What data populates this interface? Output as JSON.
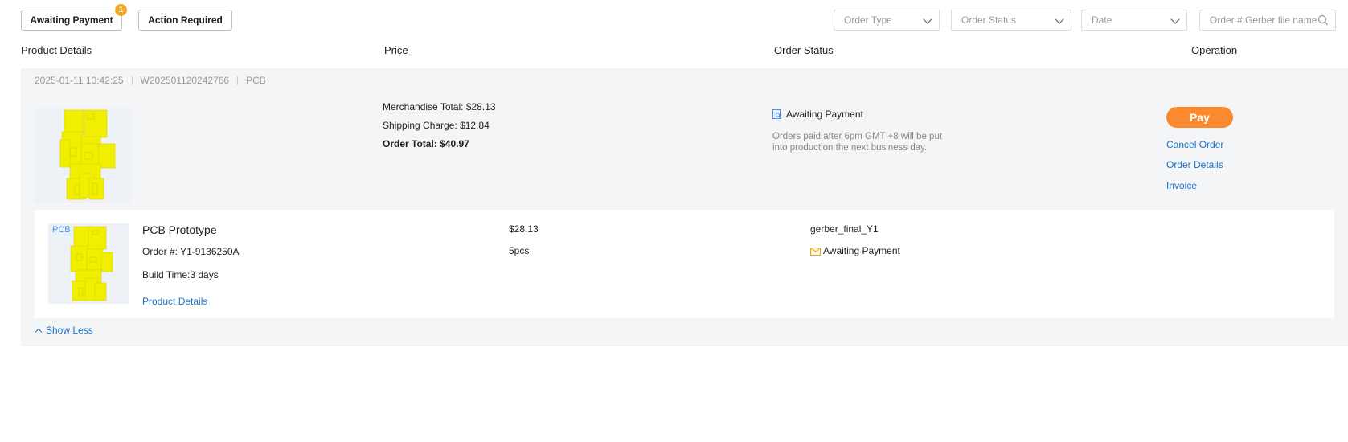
{
  "filters": {
    "awaiting_payment": {
      "label": "Awaiting Payment",
      "badge": "1"
    },
    "action_required": {
      "label": "Action Required"
    }
  },
  "dropdowns": {
    "order_type": "Order Type",
    "order_status": "Order Status",
    "date": "Date"
  },
  "search": {
    "placeholder": "Order #,Gerber file name"
  },
  "columns": {
    "product": "Product Details",
    "price": "Price",
    "status": "Order Status",
    "operation": "Operation"
  },
  "order": {
    "datetime": "2025-01-11 10:42:25",
    "number": "W202501120242766",
    "type": "PCB",
    "merchandise_total": "Merchandise Total: $28.13",
    "shipping_charge": "Shipping Charge: $12.84",
    "order_total": "Order Total: $40.97",
    "status": "Awaiting Payment",
    "note": "Orders paid after 6pm GMT +8 will be put into production the next business day.",
    "operations": {
      "pay": "Pay",
      "cancel": "Cancel Order",
      "details": "Order Details",
      "invoice": "Invoice"
    }
  },
  "item": {
    "tag": "PCB",
    "title": "PCB Prototype",
    "order_no": "Order #: Y1-9136250A",
    "build_time": "Build Time:3 days",
    "details_link": "Product Details",
    "price": "$28.13",
    "quantity": "5pcs",
    "file_name": "gerber_final_Y1",
    "status": "Awaiting Payment"
  },
  "show_less": "Show Less",
  "colors": {
    "accent_orange": "#fb8a2e",
    "badge": "#f5a623",
    "link_blue": "#1a73c9",
    "card_bg": "#f4f5f7",
    "pcb_yellow": "#f2ee00"
  },
  "icons": {
    "status_order": "search-document-icon",
    "status_item": "envelope-icon",
    "search": "magnifier-icon",
    "dropdown": "chevron-down-icon",
    "show_less": "chevron-up-icon"
  }
}
